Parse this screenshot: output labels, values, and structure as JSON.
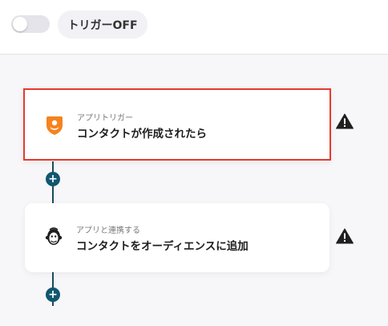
{
  "header": {
    "trigger_toggle_state": "off",
    "trigger_label": "トリガーOFF"
  },
  "flow": {
    "steps": [
      {
        "subtitle": "アプリトリガー",
        "title": "コンタクトが作成されたら",
        "icon": "orange-shield-app-icon",
        "selected": true,
        "warning": true
      },
      {
        "subtitle": "アプリと連携する",
        "title": "コンタクトをオーディエンスに追加",
        "icon": "mailchimp-monkey-icon",
        "selected": false,
        "warning": true
      }
    ],
    "add_step_symbol": "+"
  },
  "colors": {
    "selection_border": "#e8392d",
    "connector": "#1b4a5a",
    "add_button": "#10576e",
    "trigger_icon": "#f6821f"
  }
}
